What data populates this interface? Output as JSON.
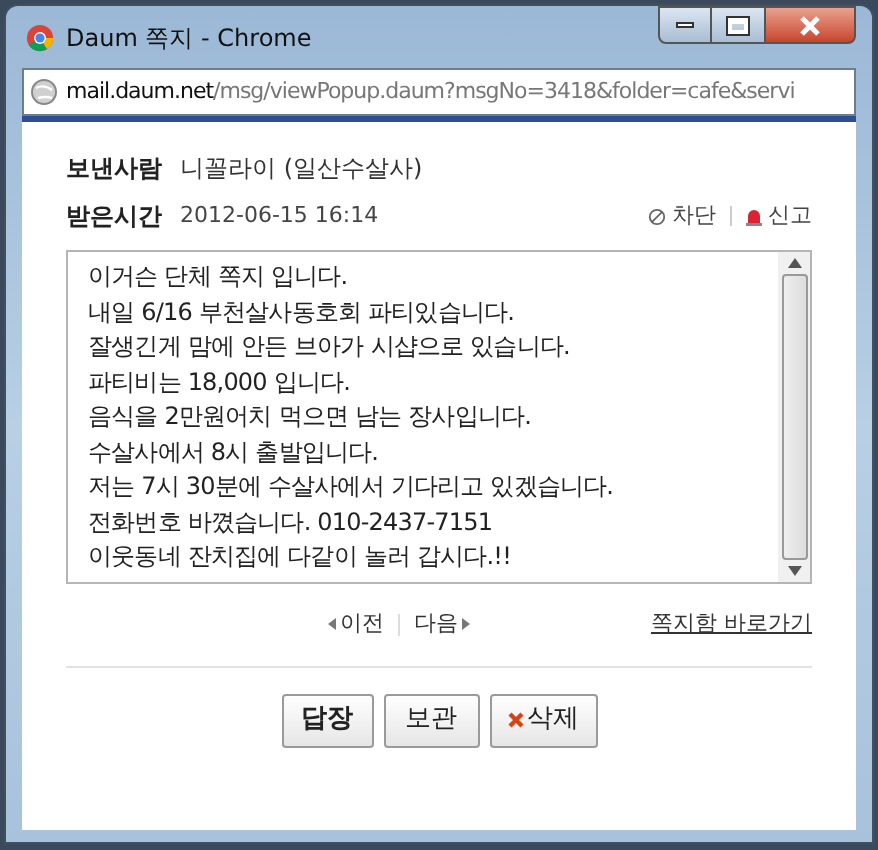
{
  "window": {
    "title": "Daum 쪽지 - Chrome"
  },
  "address_bar": {
    "host": "mail.daum.net",
    "path": "/msg/viewPopup.daum?msgNo=3418&folder=cafe&servi"
  },
  "header": {
    "sender_label": "보낸사람",
    "sender": "니꼴라이 (일산수살사)",
    "time_label": "받은시간",
    "time": "2012-06-15 16:14",
    "actions": [
      "차단",
      "신고"
    ]
  },
  "message": {
    "lines": [
      "이거슨 단체 쪽지 입니다.",
      "내일 6/16 부천살사동호회 파티있습니다.",
      "잘생긴게 맘에 안든 브아가 시샵으로 있습니다.",
      "파티비는 18,000 입니다.",
      "음식을 2만원어치 먹으면 남는 장사입니다.",
      "수살사에서 8시 출발입니다.",
      "저는 7시 30분에 수살사에서 기다리고 있겠습니다.",
      "전화번호 바꼈습니다. 010-2437-7151",
      "이웃동네 잔치집에 다같이 놀러 갑시다.!!"
    ]
  },
  "nav": {
    "prev": "이전",
    "next": "다음",
    "inbox_link": "쪽지함 바로가기"
  },
  "buttons": [
    {
      "label": "답장",
      "kind": "primary"
    },
    {
      "label": "보관",
      "kind": "plain"
    },
    {
      "label": "삭제",
      "kind": "delete"
    }
  ]
}
